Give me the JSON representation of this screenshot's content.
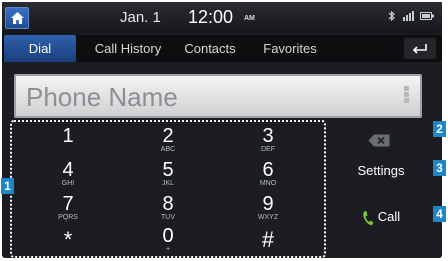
{
  "status": {
    "date": "Jan. 1",
    "time": "12:00",
    "ampm": "AM",
    "icons": "bluetooth-icon signal-icon battery-icon"
  },
  "tabs": [
    {
      "label": "Dial",
      "active": true
    },
    {
      "label": "Call History"
    },
    {
      "label": "Contacts"
    },
    {
      "label": "Favorites"
    }
  ],
  "name_field": {
    "placeholder": "Phone Name"
  },
  "keypad": [
    {
      "num": "1",
      "sub": ""
    },
    {
      "num": "2",
      "sub": "ABC"
    },
    {
      "num": "3",
      "sub": "DEF"
    },
    {
      "num": "4",
      "sub": "GHI"
    },
    {
      "num": "5",
      "sub": "JKL"
    },
    {
      "num": "6",
      "sub": "MNO"
    },
    {
      "num": "7",
      "sub": "PQRS"
    },
    {
      "num": "8",
      "sub": "TUV"
    },
    {
      "num": "9",
      "sub": "WXYZ"
    },
    {
      "num": "*",
      "sub": ""
    },
    {
      "num": "0",
      "sub": "+"
    },
    {
      "num": "#",
      "sub": ""
    }
  ],
  "actions": {
    "settings_label": "Settings",
    "call_label": "Call"
  },
  "callouts": [
    "1",
    "2",
    "3",
    "4"
  ],
  "colors": {
    "accent": "#1f4c98",
    "call_green": "#7cc23b",
    "callout_blue": "#1c86c9"
  }
}
